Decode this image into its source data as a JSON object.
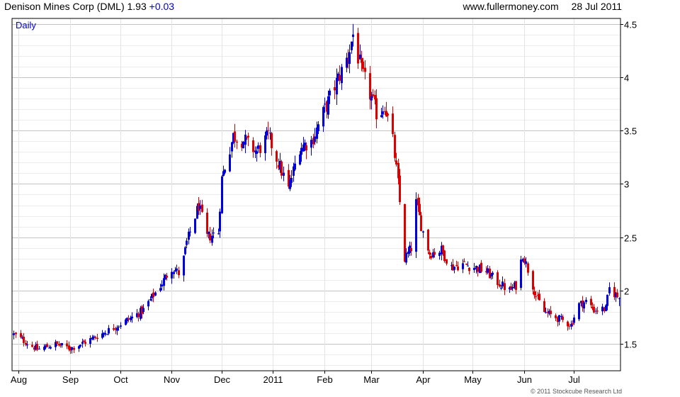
{
  "header": {
    "company": "Denison Mines Corp (DML)",
    "price": "1.93",
    "change": "+0.03",
    "site": "www.fullermoney.com",
    "date": "28 Jul 2011"
  },
  "footer": {
    "copyright": "© 2011 Stockcube Research Ltd"
  },
  "colors": {
    "up": "#0000dd",
    "down": "#dd0000",
    "grid": "#d4d4d4",
    "frame": "#000000"
  },
  "chart_data": {
    "type": "candlestick",
    "period_label": "Daily",
    "title": "Denison Mines Corp (DML)",
    "xlabel": "",
    "ylabel": "",
    "ylim": [
      1.25,
      4.55
    ],
    "yticks": [
      1.5,
      2,
      2.5,
      3,
      3.5,
      4,
      4.5
    ],
    "ytick_labels": [
      "1.5",
      "2",
      "2.5",
      "3",
      "3.5",
      "4",
      "4.5"
    ],
    "grid": true,
    "x_range": [
      "2010-07-28",
      "2011-07-29"
    ],
    "x_ticks": [
      {
        "label": "Aug",
        "date": "2010-08-01"
      },
      {
        "label": "Sep",
        "date": "2010-09-01"
      },
      {
        "label": "Oct",
        "date": "2010-10-01"
      },
      {
        "label": "Nov",
        "date": "2010-11-01"
      },
      {
        "label": "Dec",
        "date": "2010-12-01"
      },
      {
        "label": "2011",
        "date": "2011-01-01"
      },
      {
        "label": "Feb",
        "date": "2011-02-01"
      },
      {
        "label": "Mar",
        "date": "2011-03-01"
      },
      {
        "label": "Apr",
        "date": "2011-04-01"
      },
      {
        "label": "May",
        "date": "2011-05-01"
      },
      {
        "label": "Jun",
        "date": "2011-06-01"
      },
      {
        "label": "Jul",
        "date": "2011-07-01"
      }
    ],
    "close_path": [
      [
        "2010-07-29",
        1.59
      ],
      [
        "2010-08-12",
        1.45
      ],
      [
        "2010-08-23",
        1.5
      ],
      [
        "2010-09-01",
        1.46
      ],
      [
        "2010-09-10",
        1.52
      ],
      [
        "2010-09-24",
        1.63
      ],
      [
        "2010-10-08",
        1.75
      ],
      [
        "2010-10-15",
        1.82
      ],
      [
        "2010-10-25",
        2.05
      ],
      [
        "2010-11-01",
        2.22
      ],
      [
        "2010-11-06",
        2.15
      ],
      [
        "2010-11-10",
        2.45
      ],
      [
        "2010-11-17",
        2.8
      ],
      [
        "2010-11-22",
        2.5
      ],
      [
        "2010-11-29",
        2.55
      ],
      [
        "2010-12-01",
        3.05
      ],
      [
        "2010-12-08",
        3.45
      ],
      [
        "2010-12-15",
        3.4
      ],
      [
        "2010-12-22",
        3.3
      ],
      [
        "2010-12-29",
        3.45
      ],
      [
        "2011-01-04",
        3.2
      ],
      [
        "2011-01-10",
        2.95
      ],
      [
        "2011-01-17",
        3.35
      ],
      [
        "2011-01-24",
        3.4
      ],
      [
        "2011-02-01",
        3.7
      ],
      [
        "2011-02-08",
        3.95
      ],
      [
        "2011-02-15",
        4.2
      ],
      [
        "2011-02-18",
        4.4
      ],
      [
        "2011-02-23",
        4.05
      ],
      [
        "2011-03-01",
        3.8
      ],
      [
        "2011-03-05",
        3.62
      ],
      [
        "2011-03-09",
        3.75
      ],
      [
        "2011-03-14",
        3.4
      ],
      [
        "2011-03-17",
        3.0
      ],
      [
        "2011-03-21",
        2.3
      ],
      [
        "2011-03-25",
        2.4
      ],
      [
        "2011-03-28",
        2.82
      ],
      [
        "2011-04-01",
        2.55
      ],
      [
        "2011-04-05",
        2.35
      ],
      [
        "2011-04-12",
        2.38
      ],
      [
        "2011-04-18",
        2.22
      ],
      [
        "2011-04-25",
        2.25
      ],
      [
        "2011-05-02",
        2.22
      ],
      [
        "2011-05-09",
        2.18
      ],
      [
        "2011-05-16",
        2.08
      ],
      [
        "2011-05-23",
        2.0
      ],
      [
        "2011-05-27",
        2.05
      ],
      [
        "2011-05-31",
        2.35
      ],
      [
        "2011-06-03",
        2.2
      ],
      [
        "2011-06-08",
        1.95
      ],
      [
        "2011-06-13",
        1.8
      ],
      [
        "2011-06-20",
        1.75
      ],
      [
        "2011-06-24",
        1.72
      ],
      [
        "2011-06-29",
        1.68
      ],
      [
        "2011-07-04",
        1.87
      ],
      [
        "2011-07-08",
        1.9
      ],
      [
        "2011-07-13",
        1.82
      ],
      [
        "2011-07-20",
        1.83
      ],
      [
        "2011-07-22",
        2.02
      ],
      [
        "2011-07-28",
        1.93
      ]
    ]
  }
}
